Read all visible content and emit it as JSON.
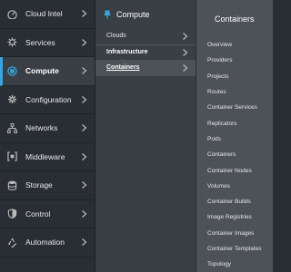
{
  "primary_nav": [
    {
      "label": "Cloud Intel",
      "icon": "dashboard-icon"
    },
    {
      "label": "Services",
      "icon": "cog-icon"
    },
    {
      "label": "Compute",
      "icon": "cpu-icon",
      "active": true
    },
    {
      "label": "Configuration",
      "icon": "gear-icon"
    },
    {
      "label": "Networks",
      "icon": "network-icon"
    },
    {
      "label": "Middleware",
      "icon": "middleware-icon"
    },
    {
      "label": "Storage",
      "icon": "database-icon"
    },
    {
      "label": "Control",
      "icon": "shield-icon"
    },
    {
      "label": "Automation",
      "icon": "recycle-icon"
    }
  ],
  "secondary_nav": {
    "title": "Compute",
    "items": [
      {
        "label": "Clouds"
      },
      {
        "label": "Infrastructure"
      },
      {
        "label": "Containers"
      }
    ]
  },
  "tertiary_nav": {
    "title": "Containers",
    "items": [
      "Overview",
      "Providers",
      "Projects",
      "Routes",
      "Container Services",
      "Replicators",
      "Pods",
      "Containers",
      "Container Nodes",
      "Volumes",
      "Container Builds",
      "Image Registries",
      "Container Images",
      "Container Templates",
      "Topology"
    ]
  },
  "colors": {
    "primary_bg": "#292e34",
    "secondary_bg": "#393f44",
    "tertiary_bg": "#4d5258",
    "accent": "#39a5dc",
    "text": "#e7e7e7"
  }
}
